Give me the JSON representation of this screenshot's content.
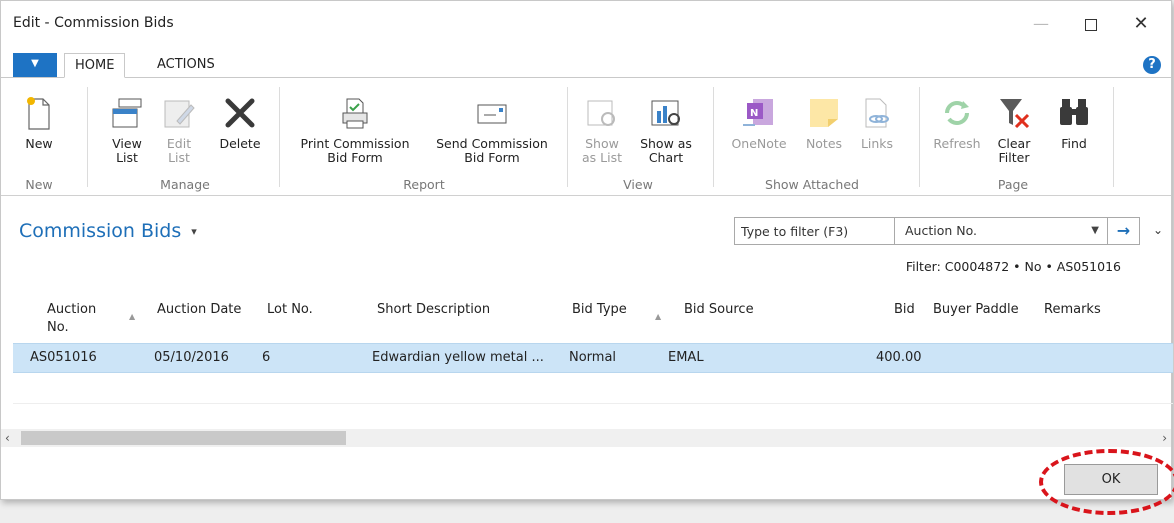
{
  "window": {
    "title": "Edit - Commission Bids",
    "min_label": "—",
    "close_label": "✕"
  },
  "tabs": {
    "app_menu": "▼",
    "home": "HOME",
    "actions": "ACTIONS",
    "help": "?"
  },
  "ribbon": {
    "groups": {
      "new": "New",
      "manage": "Manage",
      "report": "Report",
      "view": "View",
      "show_attached": "Show Attached",
      "page": "Page"
    },
    "buttons": {
      "new": "New",
      "view_list": [
        "View",
        "List"
      ],
      "edit_list": [
        "Edit",
        "List"
      ],
      "delete": "Delete",
      "print_form": [
        "Print Commission",
        "Bid Form"
      ],
      "send_form": [
        "Send Commission",
        "Bid Form"
      ],
      "show_as_list": [
        "Show",
        "as List"
      ],
      "show_as_chart": [
        "Show as",
        "Chart"
      ],
      "onenote": "OneNote",
      "notes": "Notes",
      "links": "Links",
      "refresh": "Refresh",
      "clear_filter": [
        "Clear",
        "Filter"
      ],
      "find": "Find"
    }
  },
  "page": {
    "title": "Commission Bids",
    "title_caret": "▾"
  },
  "filter": {
    "placeholder": "Type to filter (F3)",
    "field": "Auction No.",
    "dropdown": "▼",
    "go": "→",
    "collapse": "⌄",
    "summary": "Filter: C0004872 • No • AS051016"
  },
  "table": {
    "columns": {
      "auction_no": [
        "Auction",
        "No."
      ],
      "auction_date": "Auction Date",
      "lot_no": "Lot No.",
      "short_description": "Short Description",
      "bid_type": "Bid Type",
      "bid_source": "Bid Source",
      "bid": "Bid",
      "buyer_paddle": "Buyer Paddle",
      "remarks": "Remarks"
    },
    "sort_indicator": "▲",
    "rows": [
      {
        "auction_no": "AS051016",
        "auction_date": "05/10/2016",
        "lot_no": "6",
        "short_description": "Edwardian yellow metal ...",
        "bid_type": "Normal",
        "bid_source": "EMAL",
        "bid": "400.00",
        "buyer_paddle": "",
        "remarks": ""
      }
    ]
  },
  "scroll": {
    "left_arrow": "‹",
    "right_arrow": "›"
  },
  "footer": {
    "ok_label": "OK"
  },
  "colors": {
    "accent": "#1e73c4",
    "selection": "#cce4f7",
    "highlight_ring": "#d9141b"
  }
}
